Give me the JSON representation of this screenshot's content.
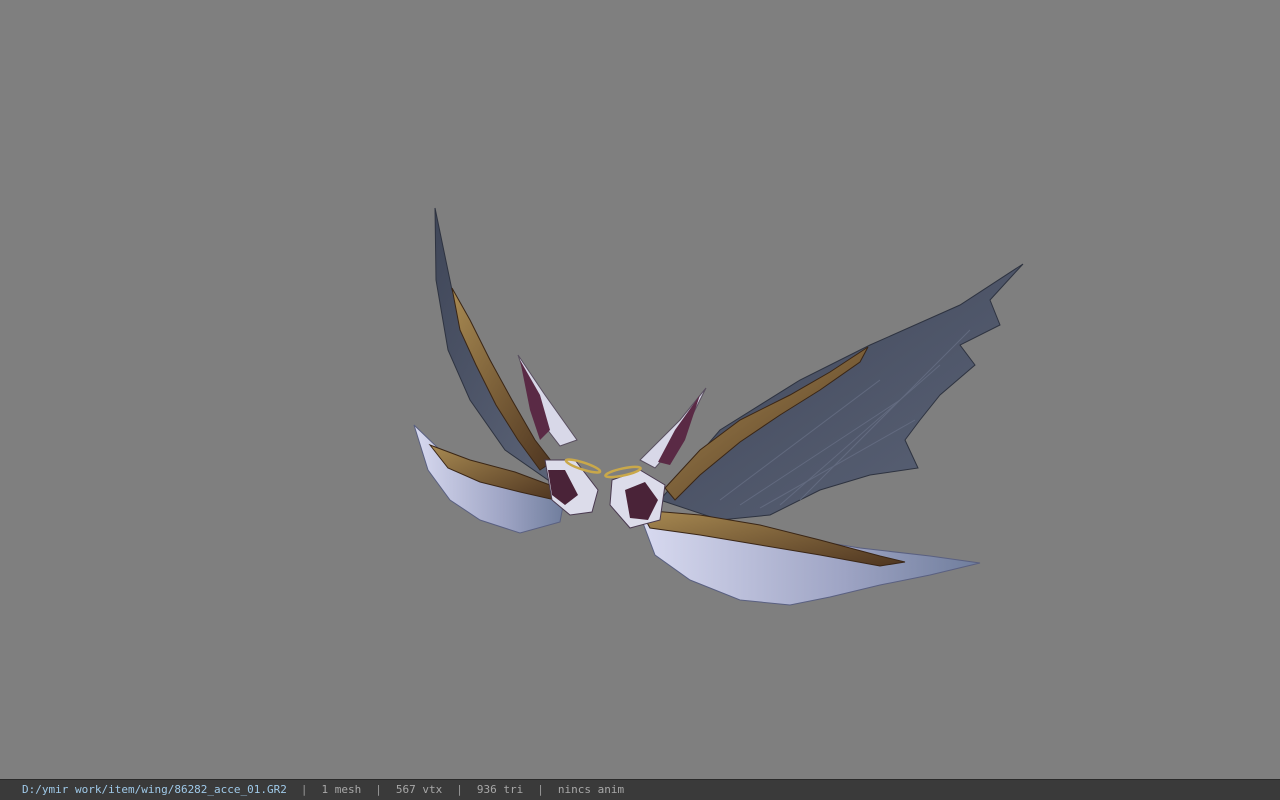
{
  "viewport": {
    "background_color": "#7f7f7f",
    "model": {
      "subject": "wing-accessory-model",
      "colors": {
        "feather_dark": "#4a5264",
        "feather_light": "#b9bdd8",
        "scales": "#6b4a2a",
        "scales_highlight": "#b89a5a",
        "flesh": "#4a2338",
        "halo": "#c9a84a"
      }
    }
  },
  "statusbar": {
    "file_path": "D:/ymir work/item/wing/86282_acce_01.GR2",
    "separator": "|",
    "mesh_count": "1 mesh",
    "vertex_count": "567 vtx",
    "triangle_count": "936 tri",
    "animation": "nincs anim"
  }
}
